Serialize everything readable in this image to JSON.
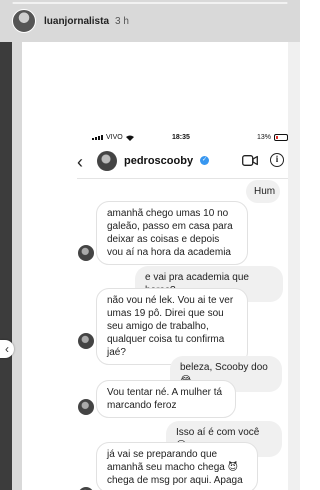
{
  "story": {
    "username": "luanjornalista",
    "time": "3 h",
    "progress": 1.0,
    "prev_icon": "chevron-left-icon",
    "prev_glyph": "‹"
  },
  "phone_status": {
    "carrier": "VIVO",
    "time": "18:35",
    "battery": "13%"
  },
  "chat": {
    "username": "pedroscooby",
    "verified_glyph": "✓",
    "back_glyph": "‹",
    "info_glyph": "i"
  },
  "messages": [
    {
      "side": "out",
      "text": "Hum"
    },
    {
      "side": "in",
      "text": "amanhã chego umas 10 no galeão, passo em casa para deixar as coisas e depois vou aí na hora da academia"
    },
    {
      "side": "out",
      "text": "e vai pra academia que horas?"
    },
    {
      "side": "in",
      "text": "não vou né lek. Vou ai te ver umas 19 pô. Direi que sou seu amigo de trabalho, qualquer coisa tu confirma jaé?"
    },
    {
      "side": "out",
      "text": "beleza, Scooby doo 😂"
    },
    {
      "side": "in",
      "text": "Vou tentar né. A mulher tá marcando feroz"
    },
    {
      "side": "out",
      "text": "Isso aí é com você 😏"
    },
    {
      "side": "in",
      "text": "já vai se preparando que amanhã seu macho chega 😈 chega de msg por aqui. Apaga"
    }
  ],
  "colors": {
    "verified": "#3897f0",
    "bubble_out": "#f0f0f0",
    "bubble_in_border": "#e1e1e1"
  }
}
